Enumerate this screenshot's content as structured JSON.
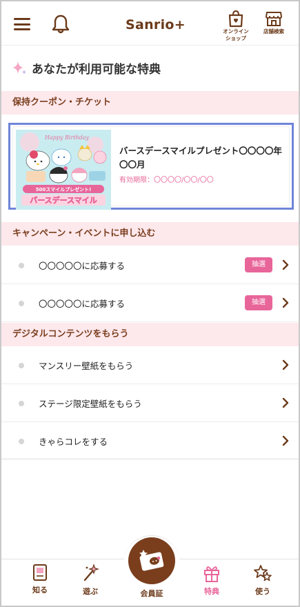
{
  "header": {
    "logo": "Sanrio+",
    "online_shop_line1": "オンライン",
    "online_shop_line2": "ショップ",
    "store_search": "店舗検索"
  },
  "page_title": "あなたが利用可能な特典",
  "coupons_section": {
    "header": "保持クーポン・チケット",
    "coupon": {
      "title": "バースデースマイルプレゼント〇〇〇〇年〇〇月",
      "expiry": "有効期限：〇〇〇〇/〇〇/〇〇",
      "image_banner_top": "500スマイルプレゼント!",
      "image_banner_main": "バースデースマイル",
      "image_script": "Happy Birthday"
    }
  },
  "campaign_section": {
    "header": "キャンペーン・イベントに申し込む",
    "items": [
      {
        "label": "〇〇〇〇〇に応募する",
        "badge": "抽選"
      },
      {
        "label": "〇〇〇〇〇に応募する",
        "badge": "抽選"
      }
    ]
  },
  "digital_section": {
    "header": "デジタルコンテンツをもらう",
    "items": [
      {
        "label": "マンスリー壁紙をもらう"
      },
      {
        "label": "ステージ限定壁紙をもらう"
      },
      {
        "label": "きゃらコレをする"
      }
    ]
  },
  "bottom_nav": {
    "items": [
      {
        "label": "知る",
        "icon": "book-icon"
      },
      {
        "label": "遊ぶ",
        "icon": "magic-wand-icon"
      },
      {
        "label": "会員証",
        "icon": "member-card-icon"
      },
      {
        "label": "特典",
        "icon": "gift-icon",
        "active": true
      },
      {
        "label": "使う",
        "icon": "stars-icon"
      }
    ]
  },
  "colors": {
    "brand_brown": "#6b3a1a",
    "accent_pink": "#e8659a",
    "section_band": "#fde8ec",
    "selection_outline": "#6f84d8"
  }
}
